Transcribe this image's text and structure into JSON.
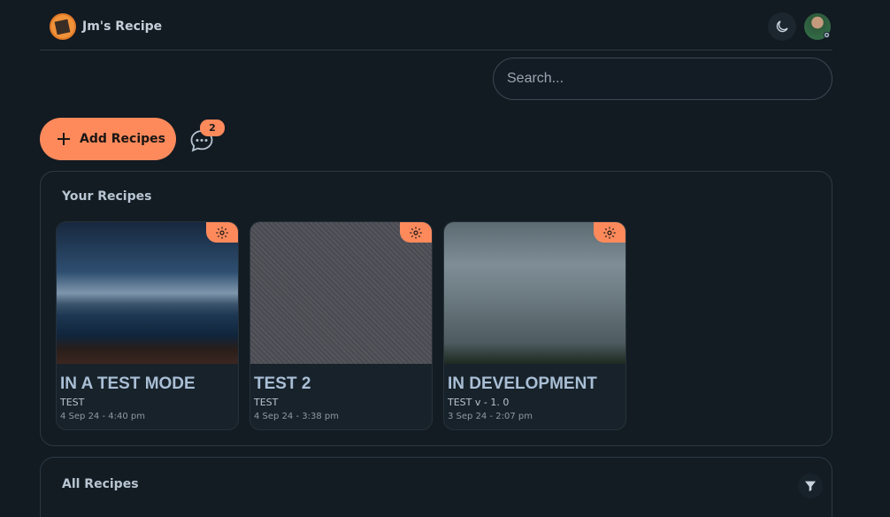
{
  "header": {
    "brand": "Jm's Recipe"
  },
  "search": {
    "placeholder": "Search..."
  },
  "actions": {
    "add_label": "Add Recipes",
    "chat_count": "2"
  },
  "your_recipes": {
    "title": "Your Recipes",
    "cards": [
      {
        "title": "IN A TEST MODE",
        "subtitle": "TEST",
        "date": "4 Sep 24 - 4:40 pm"
      },
      {
        "title": "TEST 2",
        "subtitle": "TEST",
        "date": "4 Sep 24 - 3:38 pm"
      },
      {
        "title": "IN DEVELOPMENT",
        "subtitle": "TEST v - 1. 0",
        "date": "3 Sep 24 - 2:07 pm"
      }
    ]
  },
  "all_recipes": {
    "title": "All Recipes"
  },
  "colors": {
    "accent": "#fe8a5c",
    "background": "#121a22",
    "panel": "#131c23"
  },
  "icons": [
    "app-logo-icon",
    "moon-icon",
    "user-avatar",
    "gear-icon",
    "plus-icon",
    "chat-icon",
    "filter-icon"
  ]
}
